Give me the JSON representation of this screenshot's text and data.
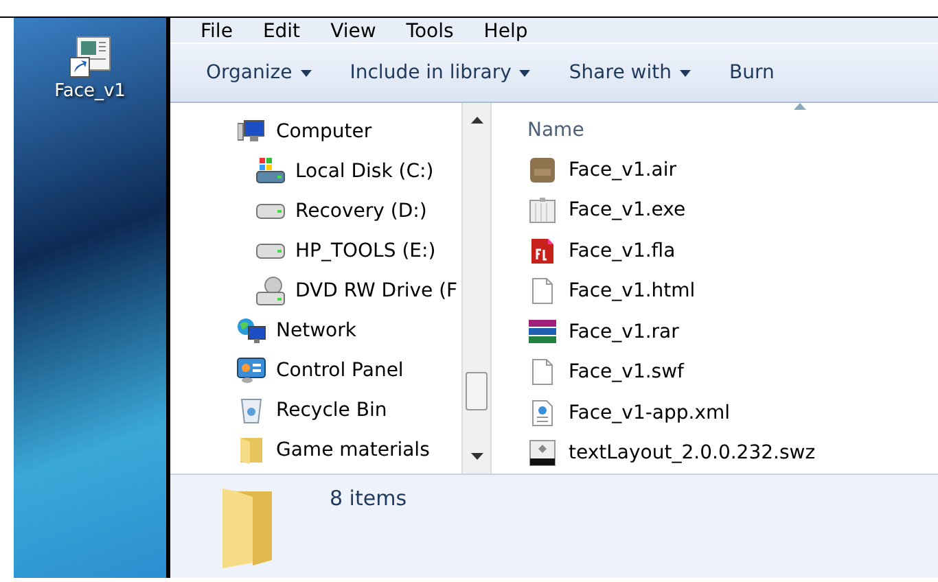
{
  "desktop": {
    "icon_label": "Face_v1"
  },
  "menu_bar": [
    "File",
    "Edit",
    "View",
    "Tools",
    "Help"
  ],
  "toolbar": [
    {
      "label": "Organize",
      "dropdown": true
    },
    {
      "label": "Include in library",
      "dropdown": true
    },
    {
      "label": "Share with",
      "dropdown": true
    },
    {
      "label": "Burn",
      "dropdown": false
    }
  ],
  "navigation": [
    {
      "label": "Computer",
      "kind": "computer",
      "children": [
        {
          "label": "Local Disk (C:)",
          "kind": "system-drive"
        },
        {
          "label": "Recovery (D:)",
          "kind": "drive"
        },
        {
          "label": "HP_TOOLS (E:)",
          "kind": "drive"
        },
        {
          "label": "DVD RW Drive (F",
          "kind": "dvd"
        }
      ]
    },
    {
      "label": "Network",
      "kind": "network"
    },
    {
      "label": "Control Panel",
      "kind": "control-panel"
    },
    {
      "label": "Recycle Bin",
      "kind": "recycle-bin"
    },
    {
      "label": "Game materials",
      "kind": "folder"
    }
  ],
  "file_list": {
    "column": "Name",
    "files": [
      {
        "name": "Face_v1.air",
        "kind": "air"
      },
      {
        "name": "Face_v1.exe",
        "kind": "exe"
      },
      {
        "name": "Face_v1.fla",
        "kind": "fla"
      },
      {
        "name": "Face_v1.html",
        "kind": "blank"
      },
      {
        "name": "Face_v1.rar",
        "kind": "rar"
      },
      {
        "name": "Face_v1.swf",
        "kind": "blank"
      },
      {
        "name": "Face_v1-app.xml",
        "kind": "xml"
      },
      {
        "name": "textLayout_2.0.0.232.swz",
        "kind": "swz"
      }
    ]
  },
  "details_pane": {
    "count": "8 items"
  }
}
